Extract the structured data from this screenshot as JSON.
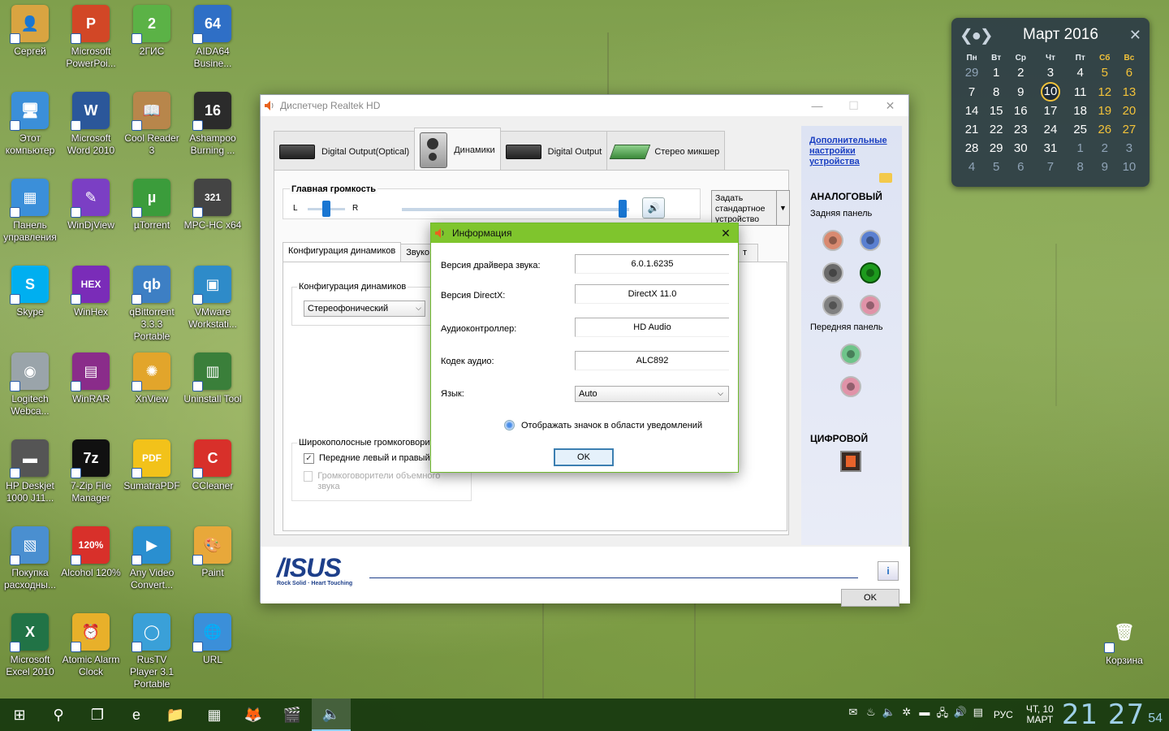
{
  "desktop": {
    "icons": [
      {
        "label": "Сергей",
        "color": "#d9a441",
        "glyph": "👤"
      },
      {
        "label": "Microsoft PowerPoi...",
        "color": "#d24726",
        "glyph": "P"
      },
      {
        "label": "2ГИС",
        "color": "#5bb246",
        "glyph": "2"
      },
      {
        "label": "AIDA64 Busine...",
        "color": "#2f6fc6",
        "glyph": "64"
      },
      {
        "label": "Этот компьютер",
        "color": "#3b8fd9",
        "glyph": "🖥"
      },
      {
        "label": "Microsoft Word 2010",
        "color": "#2b579a",
        "glyph": "W"
      },
      {
        "label": "Cool Reader 3",
        "color": "#b8864b",
        "glyph": "📖"
      },
      {
        "label": "Ashampoo Burning ...",
        "color": "#2b2b2b",
        "glyph": "16"
      },
      {
        "label": "Панель управления",
        "color": "#3b8fd9",
        "glyph": "▦"
      },
      {
        "label": "WinDjView",
        "color": "#7b3fc4",
        "glyph": "✎"
      },
      {
        "label": "µTorrent",
        "color": "#3b9c3b",
        "glyph": "µ"
      },
      {
        "label": "MPC-HC x64",
        "color": "#444444",
        "glyph": "321"
      },
      {
        "label": "Skype",
        "color": "#00aff0",
        "glyph": "S"
      },
      {
        "label": "WinHex",
        "color": "#7a2cb8",
        "glyph": "HEX"
      },
      {
        "label": "qBittorrent 3.3.3 Portable",
        "color": "#3d7fc4",
        "glyph": "qb"
      },
      {
        "label": "VMware Workstati...",
        "color": "#2e8bc9",
        "glyph": "▣"
      },
      {
        "label": "Logitech Webca...",
        "color": "#9aa4aa",
        "glyph": "◉"
      },
      {
        "label": "WinRAR",
        "color": "#8a2c8a",
        "glyph": "▤"
      },
      {
        "label": "XnView",
        "color": "#e2a52b",
        "glyph": "✺"
      },
      {
        "label": "Uninstall Tool",
        "color": "#3a7f3a",
        "glyph": "▥"
      },
      {
        "label": "HP Deskjet 1000 J11...",
        "color": "#555555",
        "glyph": "▬"
      },
      {
        "label": "7-Zip File Manager",
        "color": "#111111",
        "glyph": "7z"
      },
      {
        "label": "SumatraPDF",
        "color": "#f2c21a",
        "glyph": "PDF"
      },
      {
        "label": "CCleaner",
        "color": "#d8302a",
        "glyph": "C"
      },
      {
        "label": "Покупка расходны...",
        "color": "#4a8fd0",
        "glyph": "▧"
      },
      {
        "label": "Alcohol 120%",
        "color": "#d8302a",
        "glyph": "120%"
      },
      {
        "label": "Any Video Convert...",
        "color": "#2a8fd0",
        "glyph": "▶"
      },
      {
        "label": "Paint",
        "color": "#e8a83a",
        "glyph": "🎨"
      },
      {
        "label": "Microsoft Excel 2010",
        "color": "#217346",
        "glyph": "X"
      },
      {
        "label": "Atomic Alarm Clock",
        "color": "#e8b02a",
        "glyph": "⏰"
      },
      {
        "label": "RusTV Player 3.1 Portable",
        "color": "#3aa0d8",
        "glyph": "◯"
      },
      {
        "label": "URL",
        "color": "#3b8fd9",
        "glyph": "🌐"
      }
    ],
    "recycle_bin": {
      "label": "Корзина",
      "glyph": "🗑"
    }
  },
  "calendar": {
    "nav_glyph": "❮●❯",
    "month": "Март 2016",
    "close_glyph": "✕",
    "weekdays": [
      "Пн",
      "Вт",
      "Ср",
      "Чт",
      "Пт",
      "Сб",
      "Вс"
    ],
    "weeks": [
      [
        "29",
        "1",
        "2",
        "3",
        "4",
        "5",
        "6"
      ],
      [
        "7",
        "8",
        "9",
        "10",
        "11",
        "12",
        "13"
      ],
      [
        "14",
        "15",
        "16",
        "17",
        "18",
        "19",
        "20"
      ],
      [
        "21",
        "22",
        "23",
        "24",
        "25",
        "26",
        "27"
      ],
      [
        "28",
        "29",
        "30",
        "31",
        "1",
        "2",
        "3"
      ],
      [
        "4",
        "5",
        "6",
        "7",
        "8",
        "9",
        "10"
      ]
    ],
    "today": "10",
    "accent": "#f2c23a"
  },
  "realtek": {
    "title": "Диспетчер Realtek HD",
    "win_min": "—",
    "win_max": "☐",
    "win_close": "✕",
    "tabs": [
      "Digital Output(Optical)",
      "Динамики",
      "Digital Output",
      "Стерео микшер"
    ],
    "active_tab": "Динамики",
    "main_volume": {
      "title": "Главная громкость",
      "left": "L",
      "right": "R",
      "balance": 0.5,
      "level": 0.97,
      "mute_glyph": "🔊"
    },
    "default_device": {
      "label": "Задать стандартное устройство",
      "caret": "▼"
    },
    "subtabs": [
      "Конфигурация динамиков",
      "Звуко",
      "т"
    ],
    "speaker_config": {
      "title": "Конфигурация динамиков",
      "selected": "Стереофонический",
      "caret": "⌵"
    },
    "fullrange": {
      "title": "Широкополосные громкоговорители",
      "front_lr": "Передние левый и правый",
      "front_checked": "✓",
      "surround": "Громкоговорители объемного звука"
    },
    "side": {
      "link": "Дополнительные настройки устройства",
      "analog": "АНАЛОГОВЫЙ",
      "rear": "Задняя панель",
      "front": "Передняя панель",
      "digital": "ЦИФРОВОЙ",
      "jack_colors": [
        "#d98a70",
        "#5a7fd0",
        "#6a6a6a",
        "#1d9a1d",
        "#808080",
        "#e093a8",
        "#6fc48a",
        "#e093a8"
      ]
    },
    "brand": {
      "logo": "/ISUS",
      "tagline": "Rock Solid · Heart Touching"
    },
    "info_glyph": "i",
    "ok": "OK"
  },
  "info_dialog": {
    "title": "Информация",
    "close": "✕",
    "rows": [
      {
        "label": "Версия драйвера звука:",
        "value": "6.0.1.6235"
      },
      {
        "label": "Версия DirectX:",
        "value": "DirectX 11.0"
      },
      {
        "label": "Аудиоконтроллер:",
        "value": "HD Audio"
      },
      {
        "label": "Кодек аудио:",
        "value": "ALC892"
      }
    ],
    "language_label": "Язык:",
    "language_value": "Auto",
    "caret": "⌵",
    "tray_option": "Отображать значок в области уведомлений",
    "ok": "OK"
  },
  "taskbar": {
    "buttons": [
      {
        "name": "start-button",
        "glyph": "⊞"
      },
      {
        "name": "search-button",
        "glyph": "⚲"
      },
      {
        "name": "task-view-button",
        "glyph": "❐"
      },
      {
        "name": "edge-button",
        "glyph": "e"
      },
      {
        "name": "explorer-button",
        "glyph": "📁"
      },
      {
        "name": "calculator-button",
        "glyph": "▦"
      },
      {
        "name": "firefox-button",
        "glyph": "🦊"
      },
      {
        "name": "media-button",
        "glyph": "🎬"
      },
      {
        "name": "realtek-button",
        "glyph": "🔈"
      }
    ],
    "active_index": 8,
    "tray_icons": [
      "✉",
      "♨",
      "🔈",
      "✲",
      "▬",
      "🖧",
      "🔊",
      "▤"
    ],
    "language": "РУС",
    "day": "ЧТ, 10",
    "month": "МАРТ",
    "time": "21 27",
    "seconds": "54"
  }
}
